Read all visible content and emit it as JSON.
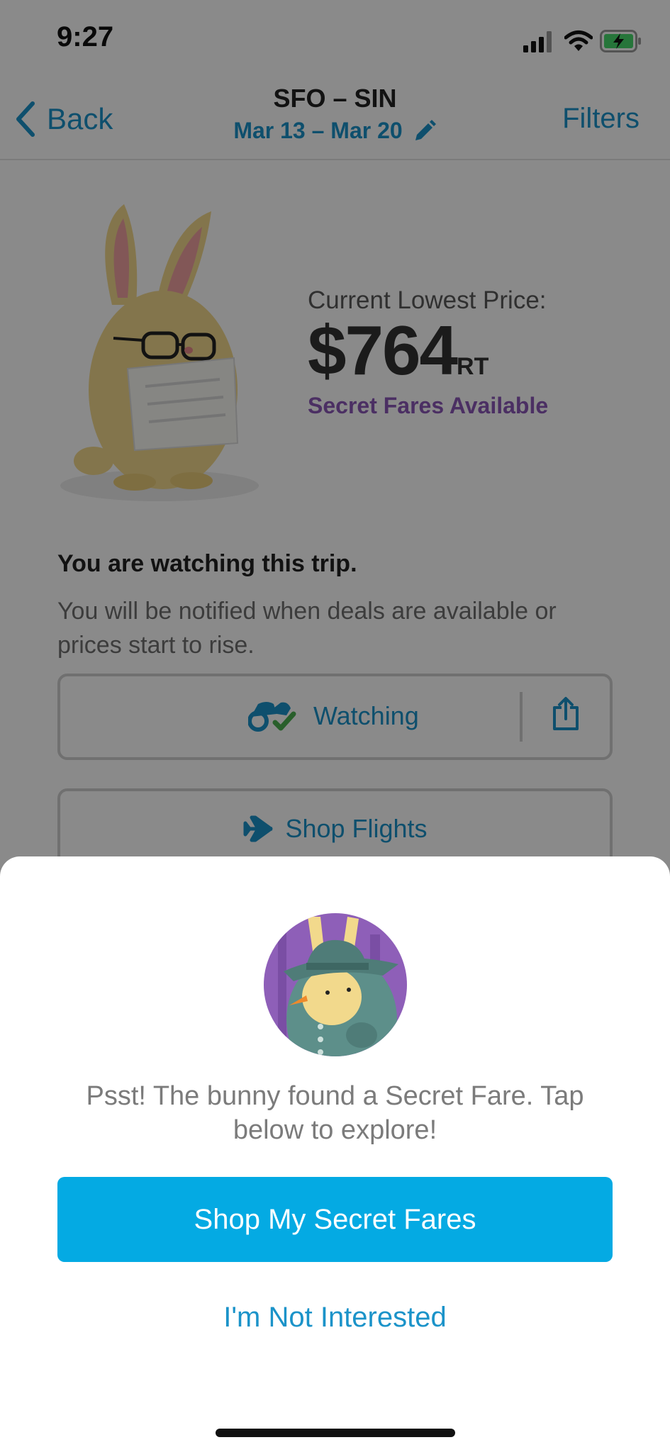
{
  "status_bar": {
    "time": "9:27"
  },
  "nav": {
    "back_label": "Back",
    "route": "SFO – SIN",
    "dates": "Mar 13 – Mar 20",
    "filters_label": "Filters"
  },
  "price": {
    "label": "Current Lowest Price:",
    "amount": "$764",
    "suffix": "RT",
    "secret_label": "Secret Fares Available"
  },
  "watch": {
    "heading": "You are watching this trip.",
    "body": "You will be notified when deals are available or prices start to rise.",
    "watching_label": "Watching",
    "shop_flights_label": "Shop Flights"
  },
  "modal": {
    "message": "Psst! The bunny found a Secret Fare. Tap below to explore!",
    "primary_label": "Shop My Secret Fares",
    "secondary_label": "I'm Not Interested"
  },
  "colors": {
    "accent": "#1b93c9",
    "primary_button": "#04aae3",
    "secret_purple": "#8b58b8"
  },
  "icons": [
    "chevron-left-icon",
    "pencil-icon",
    "binoculars-check-icon",
    "share-icon",
    "airplane-icon",
    "signal-icon",
    "wifi-icon",
    "battery-charging-icon"
  ]
}
